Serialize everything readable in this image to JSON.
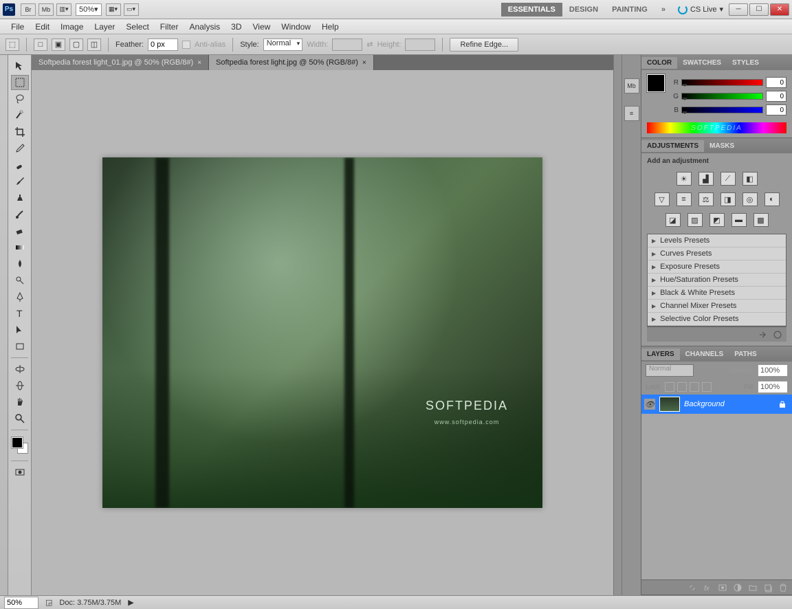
{
  "titlebar": {
    "zoom": "50%",
    "workspaces": [
      "ESSENTIALS",
      "DESIGN",
      "PAINTING"
    ],
    "cslive": "CS Live"
  },
  "menubar": [
    "File",
    "Edit",
    "Image",
    "Layer",
    "Select",
    "Filter",
    "Analysis",
    "3D",
    "View",
    "Window",
    "Help"
  ],
  "optionsbar": {
    "feather_label": "Feather:",
    "feather_value": "0 px",
    "antialias_label": "Anti-alias",
    "style_label": "Style:",
    "style_value": "Normal",
    "width_label": "Width:",
    "height_label": "Height:",
    "refine_btn": "Refine Edge..."
  },
  "doc_tabs": [
    {
      "label": "Softpedia forest light_01.jpg @ 50% (RGB/8#)",
      "active": false
    },
    {
      "label": "Softpedia forest light.jpg @ 50% (RGB/8#)",
      "active": true
    }
  ],
  "image": {
    "watermark": "SOFTPEDIA",
    "sub": "www.softpedia.com"
  },
  "panels": {
    "color": {
      "tabs": [
        "COLOR",
        "SWATCHES",
        "STYLES"
      ],
      "r_label": "R",
      "r_val": "0",
      "g_label": "G",
      "g_val": "0",
      "b_label": "B",
      "b_val": "0",
      "spectrum_text": "SOFTPEDIA"
    },
    "adjustments": {
      "tabs": [
        "ADJUSTMENTS",
        "MASKS"
      ],
      "title": "Add an adjustment",
      "presets": [
        "Levels Presets",
        "Curves Presets",
        "Exposure Presets",
        "Hue/Saturation Presets",
        "Black & White Presets",
        "Channel Mixer Presets",
        "Selective Color Presets"
      ]
    },
    "layers": {
      "tabs": [
        "LAYERS",
        "CHANNELS",
        "PATHS"
      ],
      "blend": "Normal",
      "opacity_label": "Opacity:",
      "opacity_val": "100%",
      "lock_label": "Lock:",
      "fill_label": "Fill:",
      "fill_val": "100%",
      "layer_name": "Background"
    }
  },
  "statusbar": {
    "zoom": "50%",
    "doc": "Doc: 3.75M/3.75M"
  }
}
